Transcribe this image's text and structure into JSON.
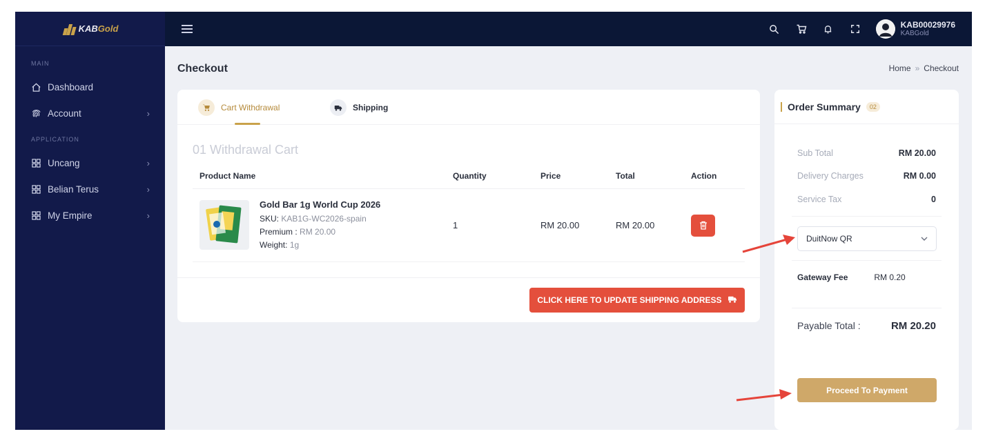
{
  "app": {
    "logo_text_k": "KAB",
    "logo_text_gold": "Gold"
  },
  "sidebar": {
    "sections": [
      {
        "label": "MAIN"
      },
      {
        "label": "APPLICATION"
      }
    ],
    "items": [
      {
        "label": "Dashboard",
        "icon": "home-icon",
        "chevron": ""
      },
      {
        "label": "Account",
        "icon": "fingerprint-icon",
        "chevron": "›"
      },
      {
        "label": "Uncang",
        "icon": "grid-icon",
        "chevron": "›"
      },
      {
        "label": "Belian Terus",
        "icon": "grid-icon",
        "chevron": "›"
      },
      {
        "label": "My Empire",
        "icon": "grid-icon",
        "chevron": "›"
      }
    ]
  },
  "topbar": {
    "user_name": "KAB00029976",
    "user_sub": "KABGold"
  },
  "page": {
    "title": "Checkout",
    "breadcrumb": [
      "Home",
      "»",
      "Checkout"
    ]
  },
  "tabs": [
    {
      "label": "Cart Withdrawal",
      "icon": "cart-icon",
      "active": true
    },
    {
      "label": "Shipping",
      "icon": "truck-icon",
      "active": false
    }
  ],
  "cart": {
    "heading": "01 Withdrawal Cart",
    "columns": [
      "Product Name",
      "Quantity",
      "Price",
      "Total",
      "Action"
    ],
    "rows": [
      {
        "name": "Gold Bar 1g World Cup 2026",
        "sku_label": "SKU:",
        "sku_value": "KAB1G-WC2026-spain",
        "premium_label": "Premium :",
        "premium_value": "RM 20.00",
        "weight_label": "Weight:",
        "weight_value": "1g",
        "quantity": "1",
        "price": "RM 20.00",
        "total": "RM 20.00"
      }
    ],
    "update_shipping_label": "CLICK HERE TO UPDATE SHIPPING ADDRESS"
  },
  "summary": {
    "title": "Order Summary",
    "badge": "02",
    "sub_total_label": "Sub Total",
    "sub_total_value": "RM 20.00",
    "delivery_label": "Delivery Charges",
    "delivery_value": "RM 0.00",
    "tax_label": "Service Tax",
    "tax_value": "0",
    "payment_method": "DuitNow QR",
    "gateway_label": "Gateway Fee",
    "gateway_value": "RM 0.20",
    "payable_label": "Payable Total :",
    "payable_value": "RM 20.20",
    "proceed_label": "Proceed To Payment"
  },
  "colors": {
    "sidebar_bg": "#121a4a",
    "topbar_bg": "#0b1736",
    "accent_gold": "#c9a24a",
    "danger": "#e44f3c",
    "annotation_arrow": "#e5443a"
  }
}
